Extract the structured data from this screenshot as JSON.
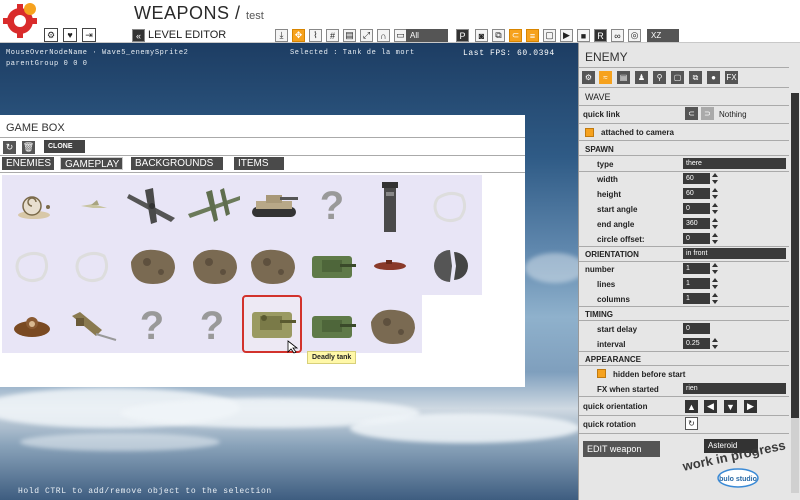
{
  "header": {
    "title": "WEAPONS /",
    "subtitle": "test",
    "editor_label": "LEVEL EDITOR",
    "filter_value": "All",
    "axis_value": "XZ",
    "toolbar_letters": [
      "P",
      "R"
    ]
  },
  "overlay": {
    "mouse_over": "MouseOverNodeName  ·  Wave5_enemySprite2",
    "parent_group": "parentGroup  0 0 0",
    "selected": "Selected :  Tank de la mort",
    "fps": "Last  FPS: 60.0394",
    "hint": "Hold CTRL to add/remove object to the selection"
  },
  "gamebox": {
    "title": "GAME BOX",
    "clone_label": "CLONE",
    "tabs": [
      "ENEMIES",
      "GAMEPLAY",
      "BACKGROUNDS",
      "ITEMS"
    ],
    "tooltip": "Deadly tank",
    "items": [
      "snail",
      "bird",
      "bomber-plane",
      "twin-plane",
      "tank",
      "unknown",
      "tower",
      "empty",
      "empty",
      "empty",
      "asteroid",
      "asteroid",
      "asteroid",
      "green-tank",
      "sub",
      "split-ball",
      "monkey",
      "walker",
      "unknown",
      "unknown",
      "deadly-tank",
      "green-tank",
      "asteroid"
    ]
  },
  "panel": {
    "title": "ENEMY",
    "section": "WAVE",
    "quick_link_label": "quick link",
    "quick_link_value": "Nothing",
    "attached_label": "attached to camera",
    "spawn_header": "SPAWN",
    "type_label": "type",
    "type_value": "there",
    "width_label": "width",
    "width_value": "60",
    "height_label": "height",
    "height_value": "60",
    "start_angle_label": "start angle",
    "start_angle_value": "0",
    "end_angle_label": "end angle",
    "end_angle_value": "360",
    "circle_offset_label": "circle offset:",
    "circle_offset_value": "0",
    "orientation_header": "ORIENTATION",
    "orientation_value": "in front",
    "number_label": "number",
    "number_value": "1",
    "lines_label": "lines",
    "lines_value": "1",
    "columns_label": "columns",
    "columns_value": "1",
    "timing_header": "TIMING",
    "start_delay_label": "start delay",
    "start_delay_value": "0",
    "interval_label": "interval",
    "interval_value": "0.25",
    "appearance_header": "APPEARANCE",
    "hidden_label": "hidden before start",
    "fx_label": "FX when started",
    "fx_value": "rien",
    "quick_orientation_label": "quick orientation",
    "quick_rotation_label": "quick rotation",
    "edit_weapon_label": "EDIT weapon",
    "weapon_value": "Asteroid"
  },
  "watermark": {
    "line1": "work in progress",
    "line2": "bulo studio"
  },
  "colors": {
    "accent": "#f6a21e",
    "selection": "#d2322c",
    "dark": "#3a3a3a"
  }
}
